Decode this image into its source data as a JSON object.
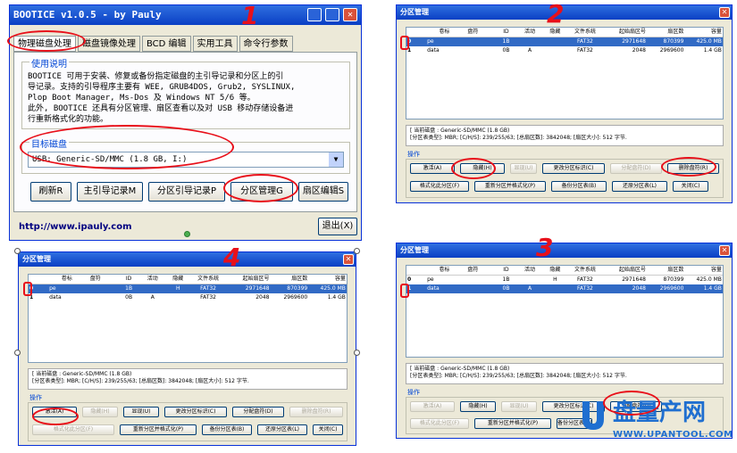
{
  "bootice": {
    "title": "BOOTICE v1.0.5 - by Pauly",
    "tabs": [
      "物理磁盘处理",
      "磁盘镜像处理",
      "BCD 编辑",
      "实用工具",
      "命令行参数"
    ],
    "usage_title": "使用说明",
    "usage_text": [
      "BOOTICE 可用于安装、修复或备份指定磁盘的主引导记录和分区上的引",
      "导记录。支持的引导程序主要有 WEE, GRUB4DOS, Grub2, SYSLINUX,",
      "Plop Boot Manager, Ms-Dos 及 Windows NT 5/6 等。",
      "此外, BOOTICE 还具有分区管理、扇区查看以及对 USB 移动存储设备进",
      "行重新格式化的功能。"
    ],
    "target_title": "目标磁盘",
    "disk_value": "USB: Generic-SD/MMC (1.8 GB, I:)",
    "buttons": [
      "刷新R",
      "主引导记录M",
      "分区引导记录P",
      "分区管理G",
      "扇区编辑S"
    ],
    "url": "http://www.ipauly.com",
    "exit": "退出(X)"
  },
  "pm": {
    "title": "分区管理",
    "columns": [
      "卷标",
      "盘符",
      "ID",
      "活动",
      "隐藏",
      "文件系统",
      "起始扇区号",
      "扇区数",
      "容量"
    ],
    "info_line1": "[ 当前磁盘 : Generic-SD/MMC (1.8 GB)",
    "info_line2": "[分区表类型]: MBR;    [C/H/S]: 239/255/63; [总扇区数]: 3842048; [扇区大小]: 512 字节.",
    "ops_label": "操作",
    "buttons_row1": [
      "激活(A)",
      "隐藏(H)",
      "显现(U)",
      "更改分区标识(C)",
      "分配盘符(D)",
      "删除盘符(R)"
    ],
    "buttons_row2": [
      "格式化此分区(F)",
      "重新分区并格式化(P)",
      "备份分区表(B)",
      "还原分区表(L)",
      "关闭(C)"
    ]
  },
  "panel2_rows": [
    [
      "0",
      "pe",
      "",
      "1B",
      "",
      "",
      "FAT32",
      "2971648",
      "870399",
      "425.0 MB"
    ],
    [
      "1",
      "data",
      "",
      "0B",
      "A",
      "",
      "FAT32",
      "2048",
      "2969600",
      "1.4 GB"
    ]
  ],
  "panel3_rows": [
    [
      "0",
      "pe",
      "",
      "1B",
      "",
      "H",
      "FAT32",
      "2971648",
      "870399",
      "425.0 MB"
    ],
    [
      "1",
      "data",
      "",
      "0B",
      "A",
      "",
      "FAT32",
      "2048",
      "2969600",
      "1.4 GB"
    ]
  ],
  "panel4_rows": [
    [
      "0",
      "pe",
      "",
      "1B",
      "",
      "H",
      "FAT32",
      "2971648",
      "870399",
      "425.0 MB"
    ],
    [
      "1",
      "data",
      "",
      "0B",
      "A",
      "",
      "FAT32",
      "2048",
      "2969600",
      "1.4 GB"
    ]
  ],
  "annotations": [
    "1",
    "2",
    "3",
    "4"
  ],
  "watermark": {
    "brand_cn": "盘量产网",
    "brand_url": "WWW.UPANTOOL.COM"
  },
  "colors": {
    "annotation_red": "#e8101a",
    "title_blue": "#0a3fc4",
    "selection": "#316ac5"
  }
}
